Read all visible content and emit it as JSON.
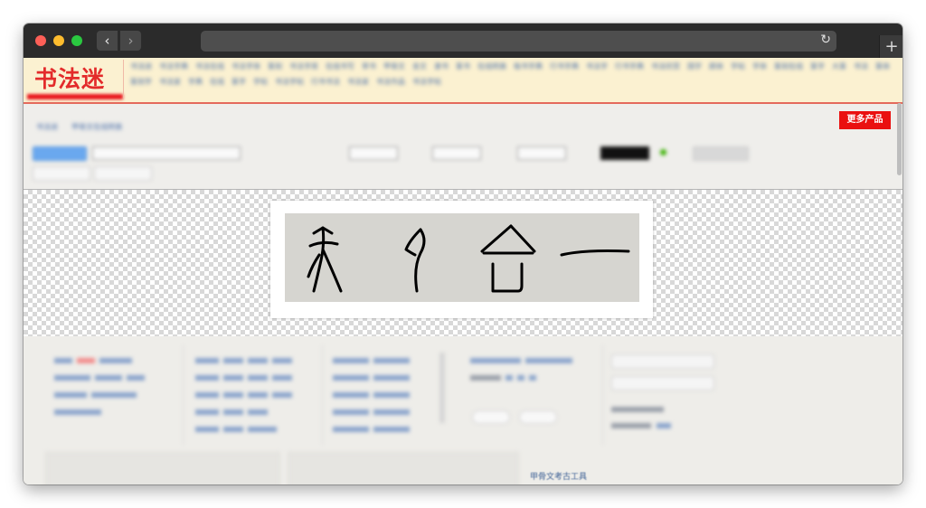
{
  "browser": {
    "back_icon": "‹",
    "forward_icon": "›",
    "reload_icon": "↻",
    "new_tab_icon": "+"
  },
  "site": {
    "logo": "书法迷",
    "nav_links": [
      "书法迷",
      "书法字典",
      "书法在线",
      "书法字体",
      "篆刻",
      "书法字库",
      "在线书写",
      "草书",
      "甲骨文",
      "金文",
      "隶书",
      "篆书",
      "在线转换",
      "楷书字典",
      "行书字典",
      "书法字",
      "行书字典",
      "书法欣赏",
      "国学",
      "颜体",
      "字帖",
      "字体",
      "篆刻在线",
      "篆字",
      "大篆",
      "书法",
      "篆体",
      "篆刻字",
      "书法家",
      "字典",
      "在线",
      "篆字",
      "字帖",
      "书法字帖",
      "行书书法",
      "书法家",
      "书法作品",
      "书法字帖"
    ],
    "breadcrumbs": [
      "书法迷",
      "甲骨文在线转换"
    ],
    "more_products": "更多产品",
    "footer_link": "甲骨文考古工具"
  },
  "calligraphy": {
    "chars": [
      "天",
      "月",
      "合",
      "一"
    ]
  }
}
